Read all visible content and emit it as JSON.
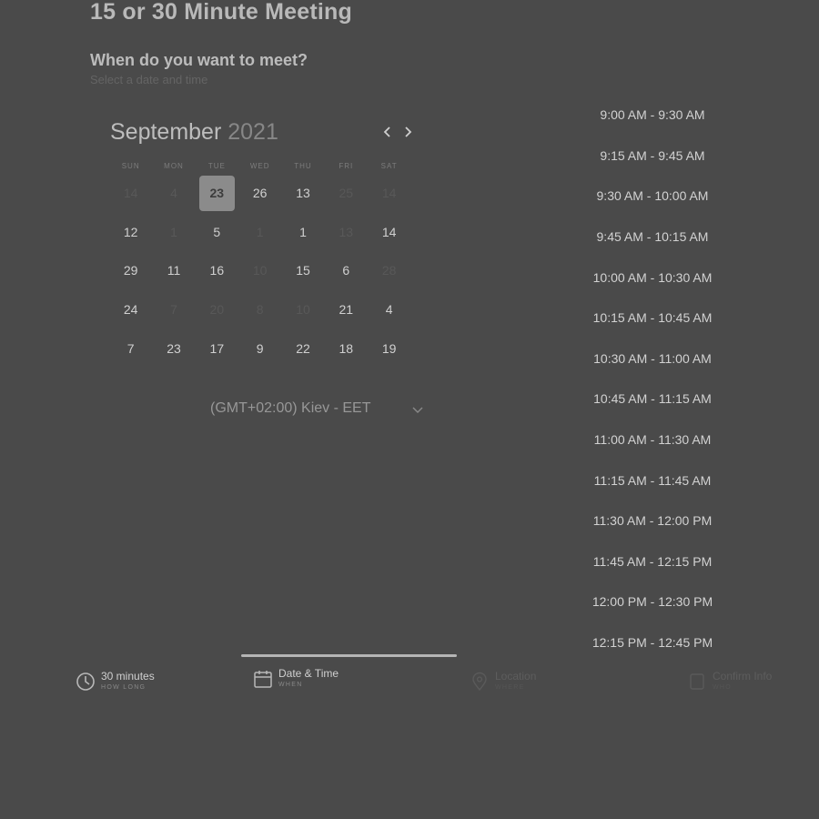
{
  "header": {
    "title": "15 or 30 Minute Meeting",
    "question": "When do you want to meet?",
    "hint": "Select a date and time"
  },
  "calendar": {
    "month": "September",
    "year": "2021",
    "weekdays": [
      "SUN",
      "MON",
      "TUE",
      "WED",
      "THU",
      "FRI",
      "SAT"
    ],
    "rows": [
      [
        {
          "d": "14",
          "off": true
        },
        {
          "d": "4",
          "off": true
        },
        {
          "d": "23",
          "sel": true
        },
        {
          "d": "26"
        },
        {
          "d": "13"
        },
        {
          "d": "25",
          "off": true
        },
        {
          "d": "14",
          "off": true
        }
      ],
      [
        {
          "d": "12"
        },
        {
          "d": "1",
          "off": true
        },
        {
          "d": "5"
        },
        {
          "d": "1",
          "off": true
        },
        {
          "d": "1"
        },
        {
          "d": "13",
          "off": true
        },
        {
          "d": "14"
        }
      ],
      [
        {
          "d": "29"
        },
        {
          "d": "11"
        },
        {
          "d": "16"
        },
        {
          "d": "10",
          "off": true
        },
        {
          "d": "15"
        },
        {
          "d": "6"
        },
        {
          "d": "28",
          "off": true
        }
      ],
      [
        {
          "d": "24"
        },
        {
          "d": "7",
          "off": true
        },
        {
          "d": "20",
          "off": true
        },
        {
          "d": "8",
          "off": true
        },
        {
          "d": "10",
          "off": true
        },
        {
          "d": "21"
        },
        {
          "d": "4"
        }
      ],
      [
        {
          "d": "7"
        },
        {
          "d": "23"
        },
        {
          "d": "17"
        },
        {
          "d": "9"
        },
        {
          "d": "22"
        },
        {
          "d": "18"
        },
        {
          "d": "19"
        }
      ]
    ]
  },
  "timezone": {
    "label": "(GMT+02:00) Kiev - EET"
  },
  "time_slots": [
    "9:00 AM - 9:30 AM",
    "9:15 AM - 9:45 AM",
    "9:30 AM - 10:00 AM",
    "9:45 AM - 10:15 AM",
    "10:00 AM - 10:30 AM",
    "10:15 AM - 10:45 AM",
    "10:30 AM - 11:00 AM",
    "10:45 AM - 11:15 AM",
    "11:00 AM - 11:30 AM",
    "11:15 AM - 11:45 AM",
    "11:30 AM - 12:00 PM",
    "11:45 AM - 12:15 PM",
    "12:00 PM - 12:30 PM",
    "12:15 PM - 12:45 PM"
  ],
  "steps": [
    {
      "label": "30 minutes",
      "sub": "HOW LONG",
      "icon": "clock-icon"
    },
    {
      "label": "Date & Time",
      "sub": "WHEN",
      "icon": "calendar-icon"
    },
    {
      "label": "Location",
      "sub": "WHERE",
      "icon": "location-pin-icon"
    },
    {
      "label": "Confirm Info",
      "sub": "WHO",
      "icon": "user-icon"
    }
  ]
}
